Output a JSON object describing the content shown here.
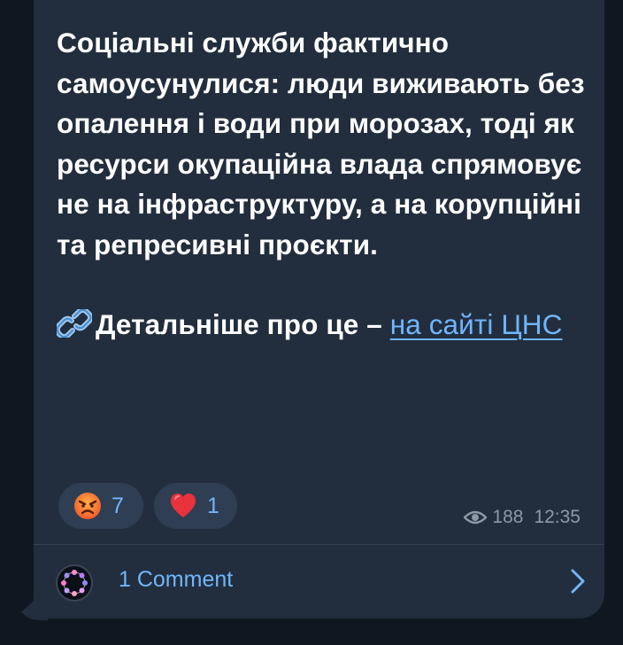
{
  "message": {
    "paragraph": "Соціальні служби фактично самоусунулися: люди виживають без опалення і води при морозах, тоді як ресурси окупаційна влада спрямовує не на інфраструктуру, а на корупційні та репресивні проєкти.",
    "more_prefix": "Детальніше про це – ",
    "link_text": "на сайті ЦНС",
    "link_icon": "link-icon"
  },
  "reactions": [
    {
      "emoji": "angry-face-emoji",
      "count": "7"
    },
    {
      "emoji": "red-heart-emoji",
      "count": "1"
    }
  ],
  "meta": {
    "views": "188",
    "time": "12:35",
    "views_icon": "eye-icon"
  },
  "comments": {
    "label": "1 Comment",
    "icon": "chevron-right-icon"
  },
  "colors": {
    "background": "#111721",
    "bubble": "#222e3d",
    "link": "#6fb6ff",
    "reaction_pill": "#2f3e52",
    "meta_text": "#8e99a8"
  }
}
